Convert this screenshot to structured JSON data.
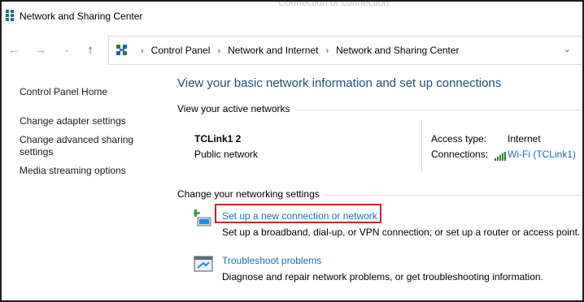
{
  "window": {
    "title": "Network and Sharing Center",
    "ghost_text": "Connection or connection"
  },
  "navigation": {
    "back_glyph": "←",
    "forward_glyph": "→",
    "recent_glyph": "⌄",
    "up_glyph": "↑",
    "breadcrumbs": [
      "Control Panel",
      "Network and Internet",
      "Network and Sharing Center"
    ],
    "separator": "›",
    "dropdown_glyph": "⌄"
  },
  "left_pane": {
    "items": [
      {
        "label": "Control Panel Home"
      },
      {
        "label": "Change adapter settings"
      },
      {
        "label": "Change advanced sharing settings"
      },
      {
        "label": "Media streaming options"
      }
    ]
  },
  "main": {
    "heading": "View your basic network information and set up connections",
    "active_networks_label": "View your active networks",
    "network": {
      "name": "TCLink1 2",
      "category": "Public network",
      "access_type_label": "Access type:",
      "access_type_value": "Internet",
      "connections_label": "Connections:",
      "connections_value": "Wi-Fi (TCLink1)",
      "icon": "wifi-signal-icon"
    },
    "change_settings_label": "Change your networking settings",
    "tasks": [
      {
        "link": "Set up a new connection or network",
        "description": "Set up a broadband, dial-up, or VPN connection; or set up a router or access point.",
        "icon": "new-connection-icon",
        "highlighted": true
      },
      {
        "link": "Troubleshoot problems",
        "description": "Diagnose and repair network problems, or get troubleshooting information.",
        "icon": "troubleshoot-icon",
        "highlighted": false
      }
    ]
  },
  "colors": {
    "heading": "#1e4e79",
    "link": "#1a6fb4",
    "highlight_border": "#c0281f",
    "window_border": "#1e1e1e"
  }
}
